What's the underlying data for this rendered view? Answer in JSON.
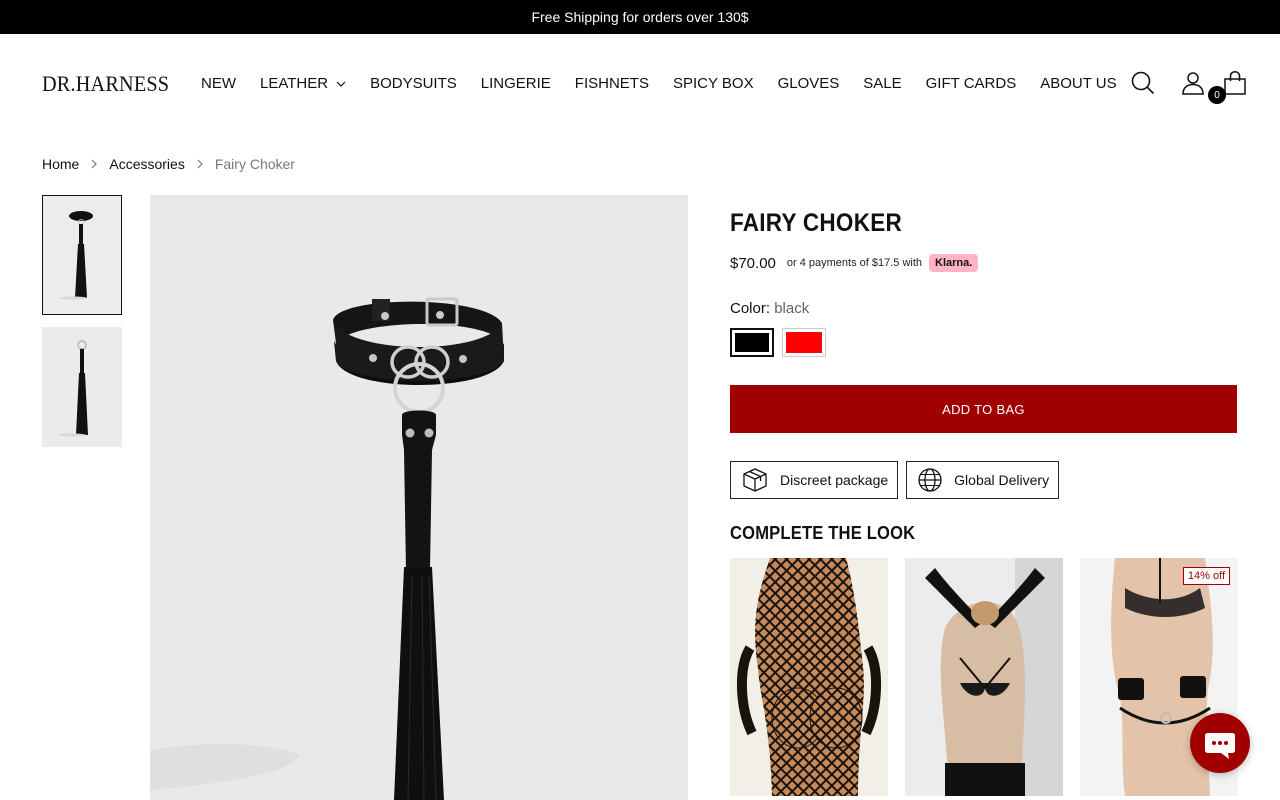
{
  "announcement": "Free Shipping for orders over 130$",
  "brand": "DR.HARNESS",
  "nav": [
    {
      "label": "NEW"
    },
    {
      "label": "LEATHER"
    },
    {
      "label": "BODYSUITS"
    },
    {
      "label": "LINGERIE"
    },
    {
      "label": "FISHNETS"
    },
    {
      "label": "SPICY BOX"
    },
    {
      "label": "GLOVES"
    },
    {
      "label": "SALE"
    },
    {
      "label": "GIFT CARDS"
    },
    {
      "label": "ABOUT US"
    }
  ],
  "header_icons": {
    "search": "search-icon",
    "account": "user-icon",
    "cart": "bag-icon",
    "cart_count": "0"
  },
  "breadcrumb": [
    "Home",
    "Accessories",
    "Fairy Choker"
  ],
  "product": {
    "title": "FAIRY CHOKER",
    "price": "$70.00",
    "installments_text": "or 4 payments of $17.5 with",
    "installments_provider": "Klarna.",
    "color_label": "Color:",
    "color_value": "black",
    "swatches": [
      {
        "name": "black",
        "color": "#000000",
        "selected": true
      },
      {
        "name": "red",
        "color": "#ff0000",
        "selected": false
      }
    ],
    "add_to_bag": "ADD TO BAG",
    "features": [
      "Discreet package",
      "Global Delivery"
    ]
  },
  "complete_the_look": {
    "heading": "COMPLETE THE LOOK",
    "items": [
      {
        "badge": ""
      },
      {
        "badge": ""
      },
      {
        "badge": "14% off"
      }
    ]
  },
  "colors": {
    "accent": "#a10000",
    "announcement_bg": "#000000",
    "klarna_pink": "#ffb3c7"
  }
}
